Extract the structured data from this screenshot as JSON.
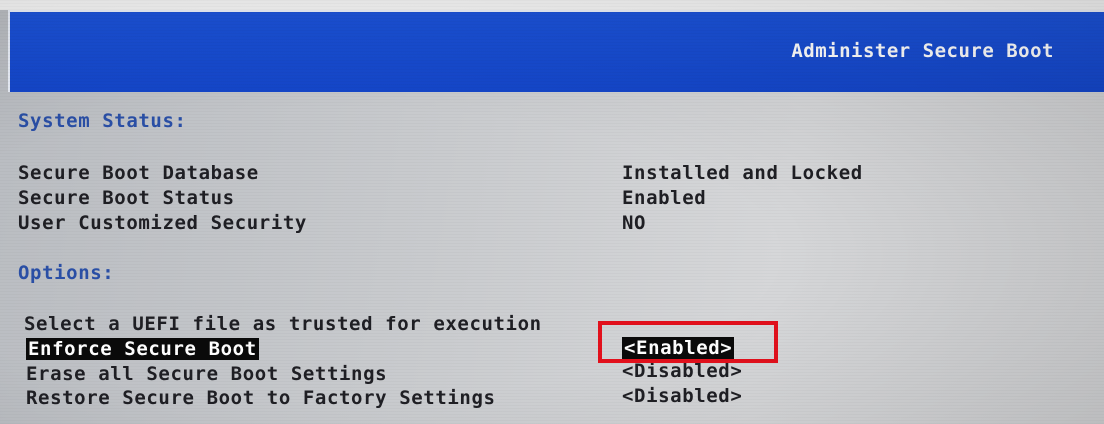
{
  "header": {
    "title": "Administer Secure Boot"
  },
  "system_status": {
    "heading": "System Status:",
    "rows": [
      {
        "label": "Secure Boot Database",
        "value": "Installed and Locked"
      },
      {
        "label": "Secure Boot Status",
        "value": "Enabled"
      },
      {
        "label": "User Customized Security",
        "value": "NO"
      }
    ]
  },
  "options": {
    "heading": "Options:",
    "items": [
      {
        "label": "Select a UEFI file as trusted for execution",
        "value": ""
      },
      {
        "label": "Enforce Secure Boot",
        "value": "<Enabled>"
      },
      {
        "label": "Erase all Secure Boot Settings",
        "value": "<Disabled>"
      },
      {
        "label": "Restore Secure Boot to Factory Settings",
        "value": "<Disabled>"
      }
    ],
    "selected_index": 1
  },
  "colors": {
    "header_bg": "#1446c9",
    "heading_text": "#2a4fa6",
    "highlight_box": "#e3101c",
    "selection_bg": "#0a0a0a"
  }
}
